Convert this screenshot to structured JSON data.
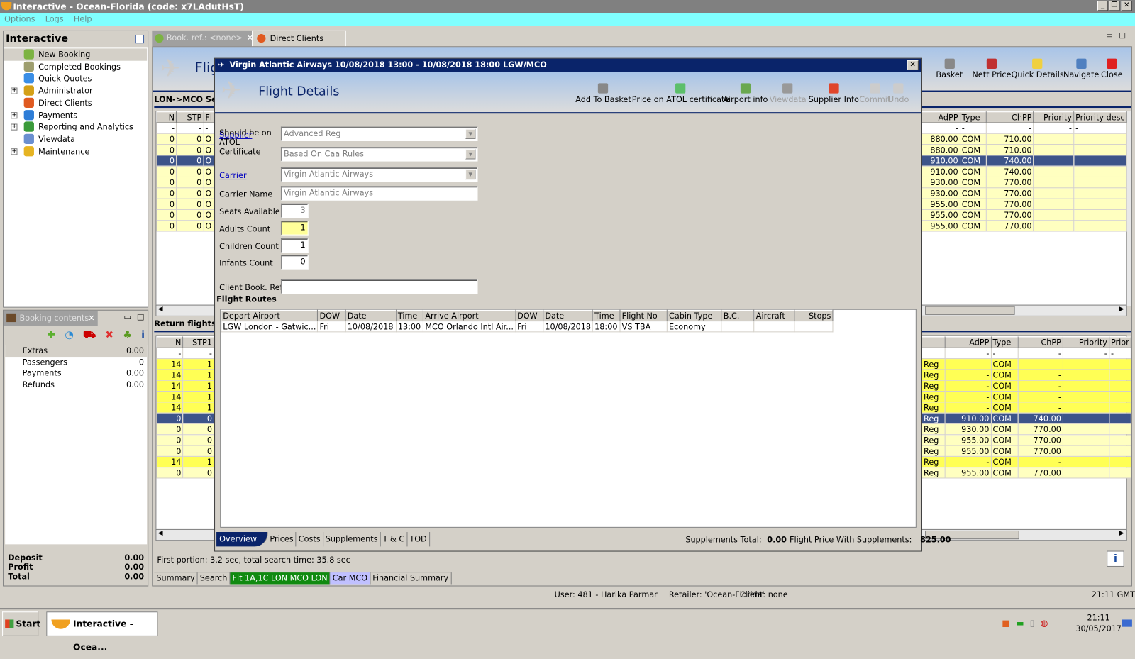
{
  "window": {
    "title": "Interactive - Ocean-Florida (code: x7LAdutHsT)"
  },
  "menu": [
    "Options",
    "Logs",
    "Help"
  ],
  "sidebar": {
    "title": "Interactive",
    "items": [
      {
        "label": "New Booking",
        "expand": false,
        "color": "#7cb342"
      },
      {
        "label": "Completed Bookings",
        "expand": false,
        "color": "#9e9e6e"
      },
      {
        "label": "Quick Quotes",
        "expand": false,
        "color": "#3a8ee6"
      },
      {
        "label": "Administrator",
        "expand": true,
        "color": "#d4a017"
      },
      {
        "label": "Direct Clients",
        "expand": false,
        "color": "#e05a20"
      },
      {
        "label": "Payments",
        "expand": true,
        "color": "#2e7dd7"
      },
      {
        "label": "Reporting and Analytics",
        "expand": true,
        "color": "#3a9a3a"
      },
      {
        "label": "Viewdata",
        "expand": false,
        "color": "#6a8fd0"
      },
      {
        "label": "Maintenance",
        "expand": true,
        "color": "#e6b422"
      }
    ]
  },
  "booking_contents": {
    "title": "Booking contents",
    "rows": [
      [
        "Extras",
        "0.00"
      ],
      [
        "Passengers",
        "0"
      ],
      [
        "Payments",
        "0.00"
      ],
      [
        "Refunds",
        "0.00"
      ]
    ],
    "totals": [
      [
        "Deposit",
        "0.00"
      ],
      [
        "Profit",
        "0.00"
      ],
      [
        "Total",
        "0.00"
      ]
    ]
  },
  "tabs": [
    {
      "label": "Book. ref.: <none>"
    },
    {
      "label": "Direct Clients Search"
    }
  ],
  "main": {
    "banner_title": "Flig",
    "outbound_title": "LON->MCO Sea",
    "return_title": "Return flights a",
    "toolbar": [
      "Basket",
      "Nett Price",
      "Quick Details",
      "Navigate",
      "Close"
    ],
    "outbound_left_headers": [
      "N",
      "STP",
      "Fl"
    ],
    "outbound_left": [
      [
        "-",
        "-",
        "-"
      ],
      [
        "0",
        "0",
        "O"
      ],
      [
        "0",
        "0",
        "O"
      ],
      [
        "0",
        "0",
        "O"
      ],
      [
        "0",
        "0",
        "O"
      ],
      [
        "0",
        "0",
        "O"
      ],
      [
        "0",
        "0",
        "O"
      ],
      [
        "0",
        "0",
        "O"
      ],
      [
        "0",
        "0",
        "O"
      ],
      [
        "0",
        "0",
        "O"
      ]
    ],
    "outbound_right_headers": [
      "AdPP",
      "Type",
      "ChPP",
      "Priority",
      "Priority desc"
    ],
    "outbound_right": [
      [
        "-",
        "-",
        "-",
        "-",
        "-"
      ],
      [
        "880.00",
        "COM",
        "710.00",
        "",
        ""
      ],
      [
        "880.00",
        "COM",
        "710.00",
        "",
        ""
      ],
      [
        "910.00",
        "COM",
        "740.00",
        "",
        ""
      ],
      [
        "910.00",
        "COM",
        "740.00",
        "",
        ""
      ],
      [
        "930.00",
        "COM",
        "770.00",
        "",
        ""
      ],
      [
        "930.00",
        "COM",
        "770.00",
        "",
        ""
      ],
      [
        "955.00",
        "COM",
        "770.00",
        "",
        ""
      ],
      [
        "955.00",
        "COM",
        "770.00",
        "",
        ""
      ],
      [
        "955.00",
        "COM",
        "770.00",
        "",
        ""
      ]
    ],
    "outbound_selected": 3,
    "return_left_headers": [
      "N",
      "STP1"
    ],
    "return_left": [
      [
        "-",
        "-"
      ],
      [
        "14",
        "1"
      ],
      [
        "14",
        "1"
      ],
      [
        "14",
        "1"
      ],
      [
        "14",
        "1"
      ],
      [
        "14",
        "1"
      ],
      [
        "0",
        "0"
      ],
      [
        "0",
        "0"
      ],
      [
        "0",
        "0"
      ],
      [
        "0",
        "0"
      ],
      [
        "14",
        "1"
      ],
      [
        "0",
        "0"
      ]
    ],
    "return_right_headers": [
      "",
      "AdPP",
      "Type",
      "ChPP",
      "Priority",
      "Prior"
    ],
    "return_right": [
      [
        "",
        "-",
        "-",
        "-",
        "-",
        "-"
      ],
      [
        "Reg",
        "-",
        "COM",
        "-",
        "",
        ""
      ],
      [
        "Reg",
        "-",
        "COM",
        "-",
        "",
        ""
      ],
      [
        "Reg",
        "-",
        "COM",
        "-",
        "",
        ""
      ],
      [
        "Reg",
        "-",
        "COM",
        "-",
        "",
        ""
      ],
      [
        "Reg",
        "-",
        "COM",
        "-",
        "",
        ""
      ],
      [
        "Reg",
        "910.00",
        "COM",
        "740.00",
        "",
        ""
      ],
      [
        "Reg",
        "930.00",
        "COM",
        "770.00",
        "",
        ""
      ],
      [
        "Reg",
        "955.00",
        "COM",
        "770.00",
        "",
        ""
      ],
      [
        "Reg",
        "955.00",
        "COM",
        "770.00",
        "",
        ""
      ],
      [
        "Reg",
        "-",
        "COM",
        "-",
        "",
        ""
      ],
      [
        "Reg",
        "955.00",
        "COM",
        "770.00",
        "",
        ""
      ]
    ],
    "return_selected": 6,
    "return_bright": [
      1,
      2,
      3,
      4,
      5,
      10
    ],
    "search_time": "First portion: 3.2 sec, total search time: 35.8 sec",
    "bottom_tabs": [
      "Summary",
      "Search",
      "Flt 1A,1C LON MCO LON",
      "Car MCO",
      "Financial Summary"
    ]
  },
  "dialog": {
    "title": "Virgin Atlantic Airways 10/08/2018 13:00 - 10/08/2018 18:00 LGW/MCO",
    "heading": "Flight Details",
    "toolbar": [
      {
        "label": "Add To Basket",
        "enabled": true,
        "color": "#888"
      },
      {
        "label": "Price on ATOL certificate",
        "enabled": true,
        "color": "#5cbf6a"
      },
      {
        "label": "Airport info",
        "enabled": true,
        "color": "#6aa84f"
      },
      {
        "label": "Viewdata",
        "enabled": false,
        "color": "#999"
      },
      {
        "label": "Supplier Info",
        "enabled": true,
        "color": "#e0452a"
      },
      {
        "label": "Commit",
        "enabled": false,
        "color": "#ccc"
      },
      {
        "label": "Undo",
        "enabled": false,
        "color": "#ccc"
      }
    ],
    "form": {
      "supplier_label": "Supplier",
      "supplier": "Advanced Reg",
      "atol_label": "Should be on ATOL Certificate",
      "atol": "Based On Caa Rules",
      "carrier_label": "Carrier",
      "carrier": "Virgin Atlantic Airways",
      "carrier_name_label": "Carrier Name",
      "carrier_name": "Virgin Atlantic Airways",
      "seats_label": "Seats Available",
      "seats": "3",
      "adults_label": "Adults Count",
      "adults": "1",
      "children_label": "Children Count",
      "children": "1",
      "infants_label": "Infants Count",
      "infants": "0",
      "client_ref_label": "Client Book. Ref.",
      "client_ref": ""
    },
    "routes_title": "Flight Routes",
    "routes_headers": [
      "Depart Airport",
      "DOW",
      "Date",
      "Time",
      "Arrive Airport",
      "DOW",
      "Date",
      "Time",
      "Flight No",
      "Cabin Type",
      "B.C.",
      "Aircraft",
      "Stops"
    ],
    "routes": [
      [
        "LGW London - Gatwic...",
        "Fri",
        "10/08/2018",
        "13:00",
        "MCO Orlando Intl Air...",
        "Fri",
        "10/08/2018",
        "18:00",
        "VS TBA",
        "Economy",
        "",
        "",
        ""
      ]
    ],
    "tabs": [
      "Overview",
      "Prices",
      "Costs",
      "Supplements",
      "T & C",
      "TOD"
    ],
    "supplements_total_label": "Supplements Total:",
    "supplements_total": "0.00",
    "flight_price_label": "Flight Price With Supplements:",
    "flight_price": "825.00"
  },
  "status": {
    "user": "User: 481 - Harika Parmar",
    "retailer": "Retailer: 'Ocean-Florida'",
    "client": "Client: none",
    "time": "21:11 GMT"
  },
  "taskbar": {
    "start": "Start",
    "app": "Interactive - Ocea...",
    "clock_time": "21:11",
    "clock_date": "30/05/2017"
  }
}
